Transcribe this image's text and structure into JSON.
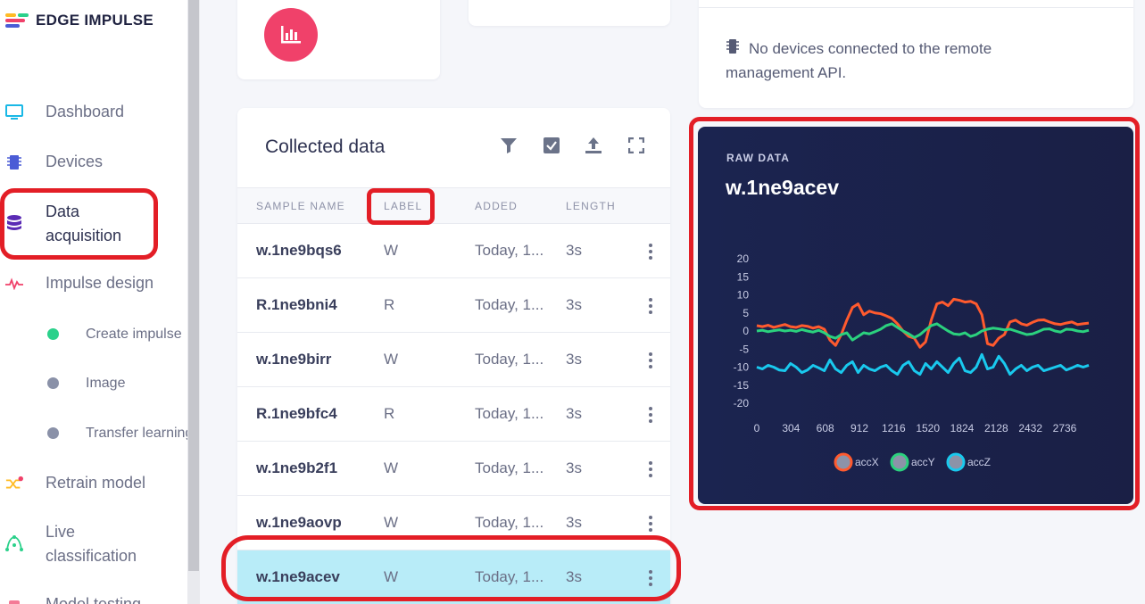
{
  "brand": {
    "name": "EDGE IMPULSE"
  },
  "sidebar": {
    "items": [
      {
        "label": "Dashboard",
        "icon": "monitor-icon"
      },
      {
        "label": "Devices",
        "icon": "chip-icon"
      },
      {
        "label": "Data acquisition",
        "line1": "Data",
        "line2": "acquisition",
        "icon": "database-icon"
      },
      {
        "label": "Impulse design",
        "icon": "pulse-icon"
      },
      {
        "label": "Retrain model",
        "icon": "shuffle-icon"
      },
      {
        "label": "Live classification",
        "line1": "Live",
        "line2": "classification",
        "icon": "network-icon"
      },
      {
        "label": "Model testing",
        "icon": "flask-icon"
      }
    ],
    "sub_items": [
      {
        "label": "Create impulse",
        "dot_color": "#2bd18b"
      },
      {
        "label": "Image",
        "dot_color": "#8a91a8"
      },
      {
        "label": "Transfer learning",
        "dot_color": "#8a91a8"
      }
    ]
  },
  "collected": {
    "title": "Collected data",
    "tools": [
      "filter-icon",
      "select-icon",
      "upload-icon",
      "expand-icon"
    ],
    "columns": [
      "SAMPLE NAME",
      "LABEL",
      "ADDED",
      "LENGTH"
    ],
    "rows": [
      {
        "name": "w.1ne9bqs6",
        "label": "W",
        "added": "Today, 1...",
        "length": "3s"
      },
      {
        "name": "R.1ne9bni4",
        "label": "R",
        "added": "Today, 1...",
        "length": "3s"
      },
      {
        "name": "w.1ne9birr",
        "label": "W",
        "added": "Today, 1...",
        "length": "3s"
      },
      {
        "name": "R.1ne9bfc4",
        "label": "R",
        "added": "Today, 1...",
        "length": "3s"
      },
      {
        "name": "w.1ne9b2f1",
        "label": "W",
        "added": "Today, 1...",
        "length": "3s"
      },
      {
        "name": "w.1ne9aovp",
        "label": "W",
        "added": "Today, 1...",
        "length": "3s"
      },
      {
        "name": "w.1ne9acev",
        "label": "W",
        "added": "Today, 1...",
        "length": "3s",
        "selected": true
      }
    ]
  },
  "devices": {
    "message_line1": "No devices connected to the remote",
    "message_line2": "management API."
  },
  "raw": {
    "eyebrow": "RAW DATA",
    "title": "w.1ne9acev"
  },
  "colors": {
    "accent_pink": "#f0416a",
    "highlight_red": "#e31e26",
    "selected_row": "#b8ecf8",
    "accX": "#ff5a2e",
    "accY": "#2bd17e",
    "accZ": "#19c9ee"
  },
  "chart_data": {
    "type": "line",
    "x": [
      0,
      50,
      100,
      150,
      200,
      250,
      300,
      350,
      400,
      450,
      500,
      550,
      600,
      650,
      700,
      750,
      800,
      850,
      900,
      950,
      1000,
      1050,
      1100,
      1150,
      1200,
      1250,
      1300,
      1350,
      1400,
      1450,
      1500,
      1550,
      1600,
      1650,
      1700,
      1750,
      1800,
      1850,
      1900,
      1950,
      2000,
      2050,
      2100,
      2150,
      2200,
      2250,
      2300,
      2350,
      2400,
      2450,
      2500,
      2550,
      2600,
      2650,
      2700,
      2750,
      2800,
      2850,
      2900,
      2950
    ],
    "series": [
      {
        "name": "accX",
        "color": "#ff5a2e",
        "values": [
          1.5,
          1.2,
          1.6,
          1.0,
          1.4,
          1.8,
          1.2,
          1.0,
          1.5,
          1.3,
          0.8,
          1.2,
          0.5,
          -2.5,
          -4.0,
          -1.0,
          3.0,
          6.5,
          7.5,
          4.5,
          5.5,
          5.0,
          4.8,
          4.2,
          3.5,
          2.0,
          0.0,
          -1.5,
          -2.0,
          -4.5,
          -3.0,
          3.0,
          7.5,
          8.0,
          7.0,
          8.8,
          8.5,
          8.0,
          8.2,
          7.5,
          4.5,
          -3.5,
          -4.0,
          -2.0,
          -1.0,
          2.5,
          3.0,
          2.0,
          1.6,
          2.4,
          3.0,
          3.1,
          2.5,
          2.0,
          1.8,
          2.2,
          2.5,
          1.8,
          2.0,
          2.2
        ]
      },
      {
        "name": "accY",
        "color": "#2bd17e",
        "values": [
          0.0,
          0.2,
          -0.2,
          0.1,
          0.3,
          0.0,
          0.2,
          -0.1,
          0.4,
          0.0,
          -0.3,
          0.2,
          -0.5,
          -1.5,
          -2.0,
          -1.0,
          -0.5,
          -2.5,
          -1.5,
          -0.5,
          -0.8,
          -0.2,
          0.5,
          1.5,
          2.0,
          1.0,
          0.0,
          -0.8,
          -1.8,
          -1.0,
          0.3,
          1.5,
          2.0,
          1.0,
          0.0,
          -0.8,
          -1.0,
          -0.5,
          -1.5,
          -1.0,
          0.0,
          0.5,
          0.8,
          0.6,
          0.3,
          0.5,
          0.0,
          -0.5,
          -1.0,
          -0.8,
          -0.2,
          0.5,
          0.6,
          0.0,
          -0.3,
          0.5,
          0.4,
          0.0,
          -0.2,
          0.2
        ]
      },
      {
        "name": "accZ",
        "color": "#19c9ee",
        "values": [
          -10.0,
          -10.5,
          -9.5,
          -10.0,
          -10.8,
          -11.0,
          -9.0,
          -10.0,
          -11.5,
          -10.8,
          -9.5,
          -10.2,
          -11.0,
          -8.0,
          -10.5,
          -11.5,
          -9.5,
          -8.5,
          -11.5,
          -9.5,
          -10.5,
          -11.0,
          -10.0,
          -9.5,
          -11.0,
          -12.0,
          -9.5,
          -8.5,
          -11.0,
          -12.0,
          -9.0,
          -10.5,
          -8.5,
          -10.0,
          -11.5,
          -9.0,
          -7.5,
          -11.0,
          -11.5,
          -10.0,
          -6.5,
          -10.5,
          -10.0,
          -7.0,
          -9.0,
          -12.0,
          -10.5,
          -9.5,
          -11.0,
          -10.0,
          -9.5,
          -11.0,
          -10.5,
          -10.0,
          -9.5,
          -10.8,
          -10.2,
          -9.5,
          -10.0,
          -9.5
        ]
      }
    ],
    "yticks": [
      20,
      15,
      10,
      5,
      0,
      -5,
      -10,
      -15,
      -20
    ],
    "xticks": [
      0,
      304,
      608,
      912,
      1216,
      1520,
      1824,
      2128,
      2432,
      2736
    ],
    "ylim": [
      -20,
      20
    ],
    "xlim": [
      0,
      2950
    ],
    "legend": "bottom",
    "grid": false
  }
}
